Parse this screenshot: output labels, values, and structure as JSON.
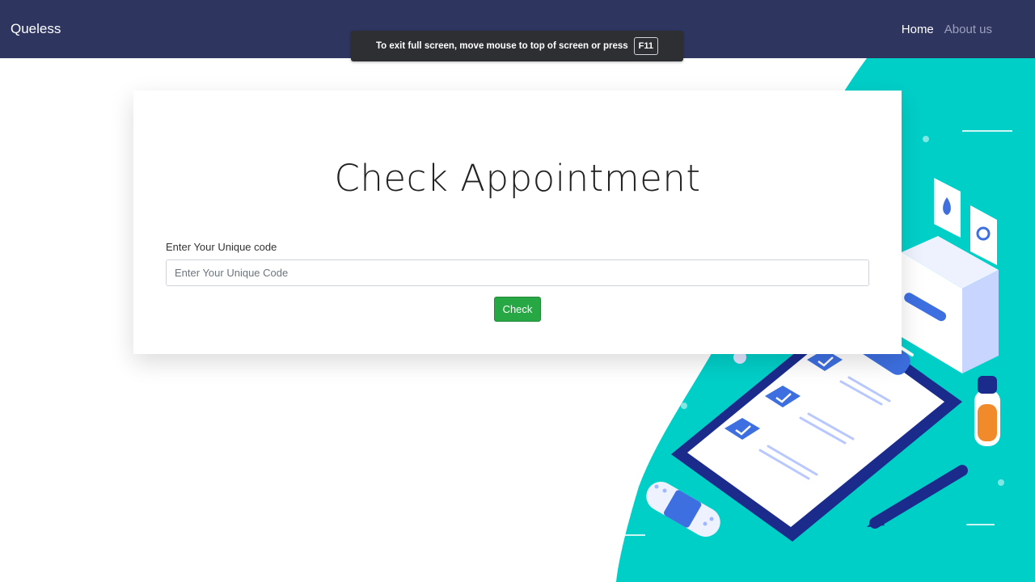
{
  "navbar": {
    "brand": "Queless",
    "links": [
      {
        "label": "Home",
        "active": true
      },
      {
        "label": "About us",
        "active": false
      }
    ]
  },
  "fullscreen_notice": {
    "message": "To exit full screen, move mouse to top of screen or press",
    "key": "F11"
  },
  "card": {
    "title": "Check Appointment",
    "field_label": "Enter Your Unique code",
    "input_placeholder": "Enter Your Unique Code",
    "input_value": "",
    "button_label": "Check"
  },
  "colors": {
    "navbar_bg": "#2e3660",
    "accent_teal": "#00cfc8",
    "button_green": "#28a745",
    "illustration_blue": "#3d6fe0",
    "illustration_navy": "#1a2b8c",
    "illustration_orange": "#f08a2a"
  }
}
